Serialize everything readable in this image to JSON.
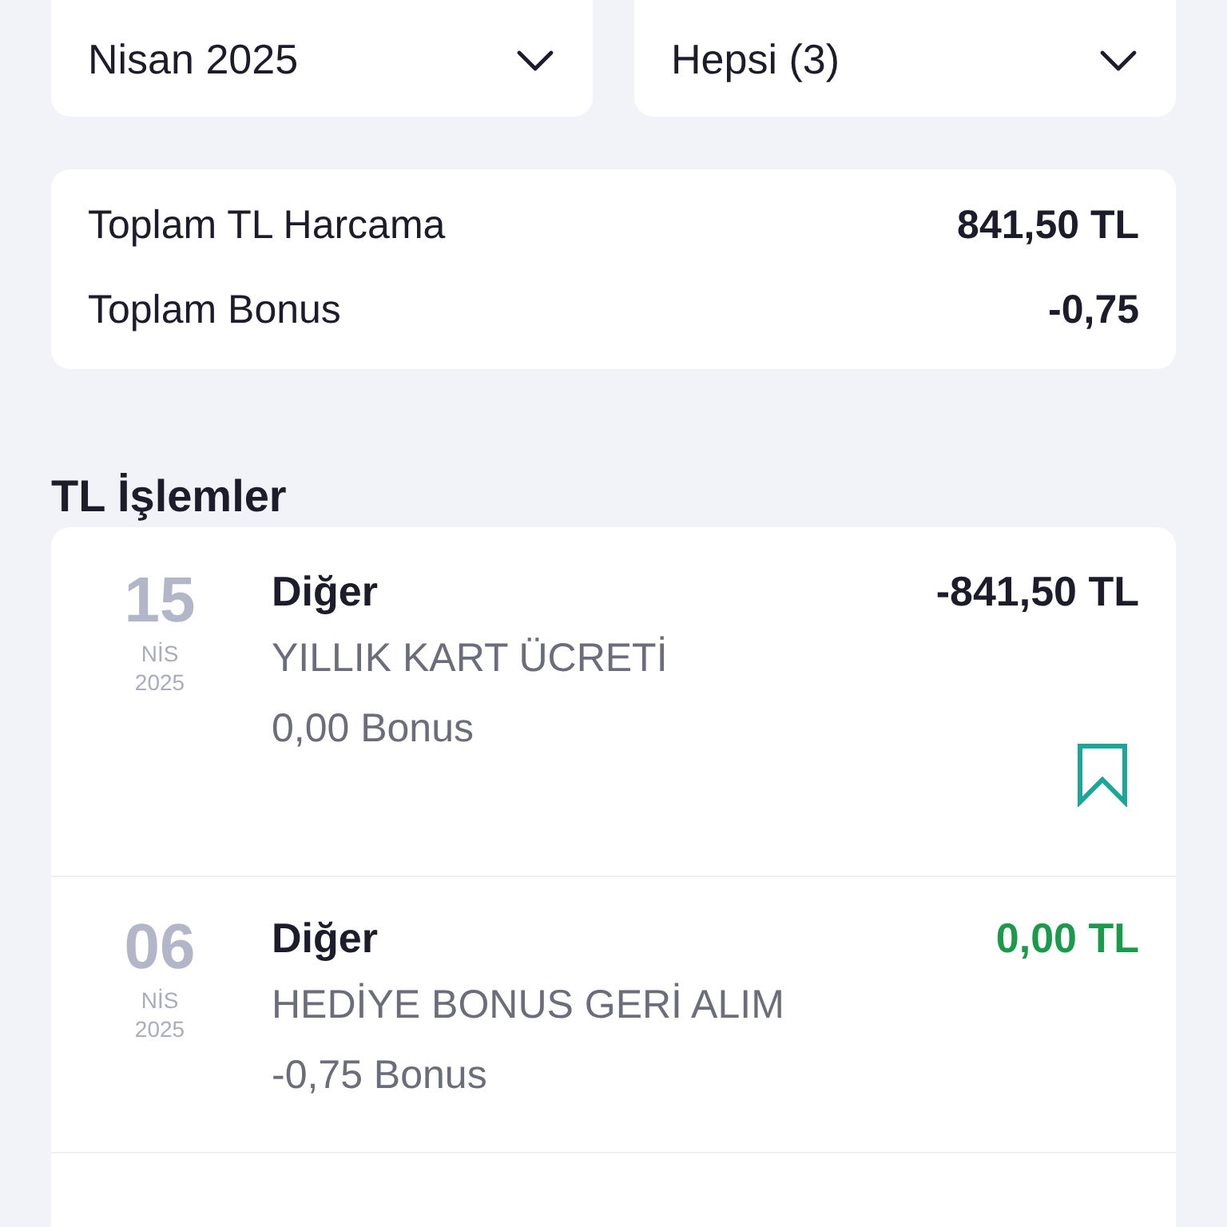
{
  "filters": [
    {
      "value": "Nisan 2025"
    },
    {
      "value": "Hepsi (3)"
    }
  ],
  "summary": [
    {
      "label": "Toplam TL Harcama",
      "value": "841,50 TL"
    },
    {
      "label": "Toplam Bonus",
      "value": "-0,75"
    }
  ],
  "section_title": "TL İşlemler",
  "transactions": [
    {
      "day": "15",
      "month": "NİS",
      "year": "2025",
      "category": "Diğer",
      "description": "YILLIK KART ÜCRETİ",
      "bonus": "0,00 Bonus",
      "amount": "-841,50 TL",
      "positive": false,
      "bookmarked": true
    },
    {
      "day": "06",
      "month": "NİS",
      "year": "2025",
      "category": "Diğer",
      "description": "HEDİYE BONUS GERİ ALIM",
      "bonus": "-0,75 Bonus",
      "amount": "0,00 TL",
      "positive": true,
      "bookmarked": false
    }
  ]
}
